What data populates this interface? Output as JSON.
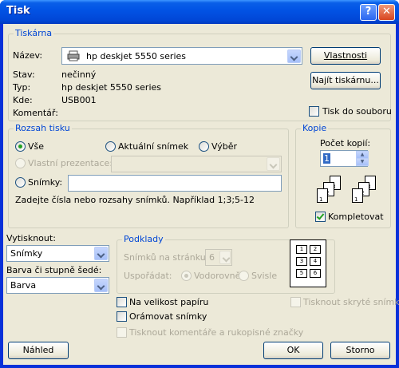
{
  "window": {
    "title": "Tisk",
    "help_glyph": "?",
    "close_glyph": "✕"
  },
  "printer": {
    "group_title": "Tiskárna",
    "name_label": "Název:",
    "name_value": "hp deskjet 5550 series",
    "properties_button": "Vlastnosti",
    "find_button": "Najít tiskárnu...",
    "status_label": "Stav:",
    "status_value": "nečinný",
    "type_label": "Typ:",
    "type_value": "hp deskjet 5550 series",
    "where_label": "Kde:",
    "where_value": "USB001",
    "comment_label": "Komentář:",
    "print_to_file_label": "Tisk do souboru"
  },
  "range": {
    "group_title": "Rozsah tisku",
    "all_label": "Vše",
    "current_slide_label": "Aktuální snímek",
    "selection_label": "Výběr",
    "custom_show_label": "Vlastní prezentace:",
    "slides_label": "Snímky:",
    "hint": "Zadejte čísla nebo rozsahy snímků. Například 1;3;5-12"
  },
  "copies": {
    "group_title": "Kopie",
    "count_label": "Počet kopií:",
    "count_value": "1",
    "collate_label": "Kompletovat",
    "page_labels": [
      "1",
      "2",
      "3"
    ]
  },
  "print_what": {
    "label": "Vytisknout:",
    "value": "Snímky"
  },
  "color": {
    "label": "Barva či stupně šedé:",
    "value": "Barva"
  },
  "handouts": {
    "group_title": "Podklady",
    "per_page_label": "Snímků na stránku:",
    "per_page_value": "6",
    "order_label": "Uspořádat:",
    "horizontal_label": "Vodorovně",
    "vertical_label": "Svisle",
    "preview_cells": [
      "1",
      "2",
      "3",
      "4",
      "5",
      "6"
    ]
  },
  "options": {
    "fit_to_paper": "Na velikost papíru",
    "frame_slides": "Orámovat snímky",
    "print_comments": "Tisknout komentáře a rukopisné značky",
    "print_hidden": "Tisknout skryté snímky"
  },
  "buttons": {
    "preview": "Náhled",
    "ok": "OK",
    "cancel": "Storno"
  }
}
